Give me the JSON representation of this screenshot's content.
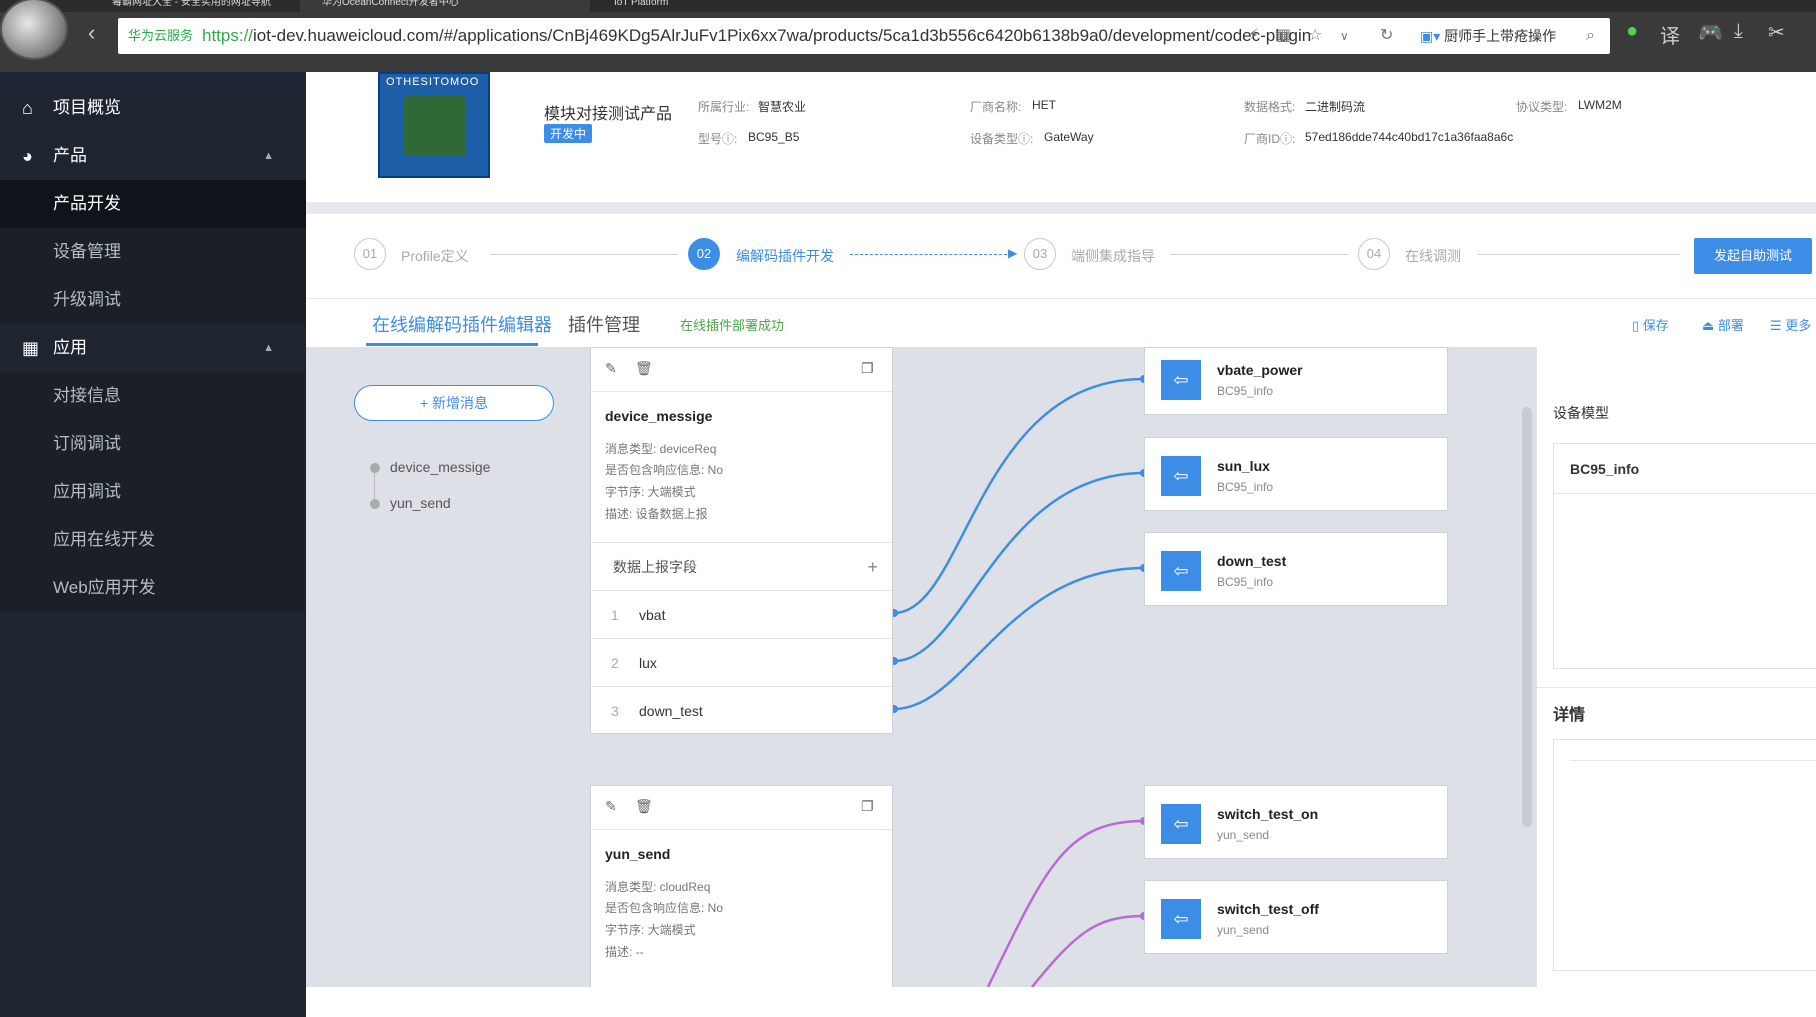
{
  "browser": {
    "tabs": [
      "毒霸网址大全 - 安全实用的网址导航",
      "华为OceanConnect开发者中心",
      "IoT Platform"
    ],
    "secure_label": "华为云服务",
    "url_scheme": "https://",
    "url_rest": "iot-dev.huaweicloud.com/#/applications/CnBj469KDg5AlrJuFv1Pix6xx7wa/products/5ca1d3b556c6420b6138b9a0/development/codec-plugin",
    "search_text": "厨师手上带疮操作",
    "translate_label": "译"
  },
  "sidebar": {
    "items": [
      {
        "label": "项目概览",
        "icon": "home-icon",
        "type": "top"
      },
      {
        "label": "产品",
        "icon": "product-icon",
        "type": "top"
      },
      {
        "label": "产品开发",
        "type": "sub",
        "active": true
      },
      {
        "label": "设备管理",
        "type": "sub"
      },
      {
        "label": "升级调试",
        "type": "sub"
      },
      {
        "label": "应用",
        "icon": "grid-icon",
        "type": "top"
      },
      {
        "label": "对接信息",
        "type": "sub"
      },
      {
        "label": "订阅调试",
        "type": "sub"
      },
      {
        "label": "应用调试",
        "type": "sub"
      },
      {
        "label": "应用在线开发",
        "type": "sub"
      },
      {
        "label": "Web应用开发",
        "type": "sub"
      }
    ]
  },
  "product": {
    "image_label": "OTHESITOMOO",
    "name": "模块对接测试产品",
    "status": "开发中",
    "fields": [
      {
        "label": "所属行业:",
        "value": "智慧农业"
      },
      {
        "label": "型号ⓘ:",
        "value": "BC95_B5"
      },
      {
        "label": "厂商名称:",
        "value": "HET"
      },
      {
        "label": "设备类型ⓘ:",
        "value": "GateWay"
      },
      {
        "label": "数据格式:",
        "value": "二进制码流"
      },
      {
        "label": "厂商IDⓘ:",
        "value": "57ed186dde744c40bd17c1a36faa8a6c"
      },
      {
        "label": "协议类型:",
        "value": "LWM2M"
      }
    ]
  },
  "steps": [
    {
      "num": "01",
      "label": "Profile定义"
    },
    {
      "num": "02",
      "label": "编解码插件开发",
      "current": true
    },
    {
      "num": "03",
      "label": "端侧集成指导"
    },
    {
      "num": "04",
      "label": "在线调测"
    }
  ],
  "start_test_label": "发起自助测试",
  "tabs": {
    "editor": "在线编解码插件编辑器",
    "manage": "插件管理",
    "deploy_status": "在线插件部署成功",
    "save": "保存",
    "deploy": "部署",
    "more": "更多"
  },
  "messages_panel": {
    "add_label": "+ 新增消息",
    "items": [
      "device_messige",
      "yun_send"
    ]
  },
  "cards": [
    {
      "title": "device_messige",
      "info": [
        "消息类型: deviceReq",
        "是否包含响应信息: No",
        "字节序: 大端模式",
        "描述: 设备数据上报"
      ],
      "field_header": "数据上报字段",
      "fields": [
        {
          "n": "1",
          "name": "vbat"
        },
        {
          "n": "2",
          "name": "lux"
        },
        {
          "n": "3",
          "name": "down_test"
        }
      ]
    },
    {
      "title": "yun_send",
      "info": [
        "消息类型: cloudReq",
        "是否包含响应信息: No",
        "字节序: 大端模式",
        "描述: --"
      ]
    }
  ],
  "properties": [
    {
      "name": "vbate_power",
      "service": "BC95_info"
    },
    {
      "name": "sun_lux",
      "service": "BC95_info"
    },
    {
      "name": "down_test",
      "service": "BC95_info"
    },
    {
      "name": "switch_test_on",
      "service": "yun_send"
    },
    {
      "name": "switch_test_off",
      "service": "yun_send"
    }
  ],
  "right_panel": {
    "model_label": "设备模型",
    "model_selected": "BC95_info",
    "detail_label": "详情"
  },
  "colors": {
    "accent": "#3d8de6",
    "sidebar_bg": "#1e2530",
    "mapping_up": "#3d8de6",
    "mapping_down": "#b86ad6",
    "success": "#4aa64a"
  }
}
